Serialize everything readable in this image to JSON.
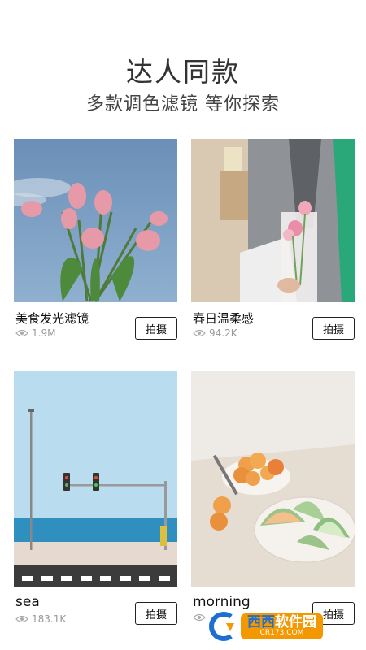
{
  "header": {
    "title": "达人同款",
    "subtitle": "多款调色滤镜 等你探索"
  },
  "cards": [
    {
      "name": "美食发光滤镜",
      "views": "1.9M",
      "button": "拍摄"
    },
    {
      "name": "春日温柔感",
      "views": "94.2K",
      "button": "拍摄"
    },
    {
      "name": "sea",
      "views": "183.1K",
      "button": "拍摄"
    },
    {
      "name": "morning",
      "views": "",
      "button": "拍摄"
    }
  ],
  "watermark": {
    "brand_a": "西西",
    "brand_b": "软件园",
    "site": "CR173.COM"
  },
  "colors": {
    "accent_watermark": "#f39800",
    "watermark_blue": "#1f6fd1"
  }
}
